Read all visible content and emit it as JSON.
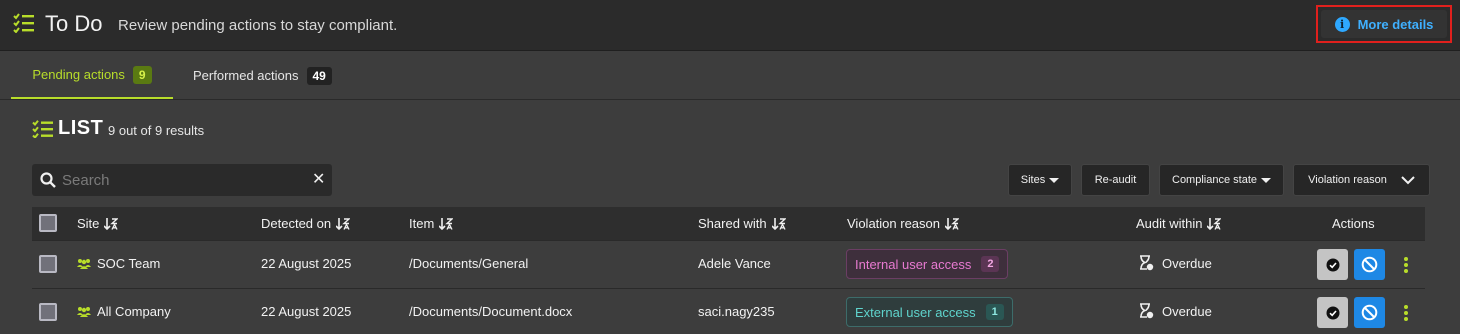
{
  "header": {
    "title": "To Do",
    "subtitle": "Review pending actions to stay compliant.",
    "more_details": "More details",
    "accent": "#b8dd2a",
    "link_color": "#3fb0ff"
  },
  "tabs": [
    {
      "label": "Pending actions",
      "count": "9",
      "active": true
    },
    {
      "label": "Performed actions",
      "count": "49",
      "active": false
    }
  ],
  "list": {
    "title": "LIST",
    "count_text": "9 out of 9 results"
  },
  "search": {
    "placeholder": "Search",
    "value": "",
    "clear_icon": "close-icon"
  },
  "filters": {
    "sites": "Sites",
    "reaudit": "Re-audit",
    "compliance_state": "Compliance state",
    "violation_reason": "Violation reason"
  },
  "table": {
    "columns": {
      "site": "Site",
      "detected_on": "Detected on",
      "item": "Item",
      "shared_with": "Shared with",
      "violation_reason": "Violation reason",
      "audit_within": "Audit within",
      "actions": "Actions"
    },
    "rows": [
      {
        "site": "SOC Team",
        "detected_on": "22 August 2025",
        "item": "/Documents/General",
        "shared_with": "Adele Vance",
        "violation": "Internal user access",
        "violation_count": "2",
        "violation_color": "pink",
        "audit_within": "Overdue"
      },
      {
        "site": "All Company",
        "detected_on": "22 August 2025",
        "item": "/Documents/Document.docx",
        "shared_with": "saci.nagy235",
        "violation": "External user access",
        "violation_count": "1",
        "violation_color": "teal",
        "audit_within": "Overdue"
      }
    ]
  }
}
